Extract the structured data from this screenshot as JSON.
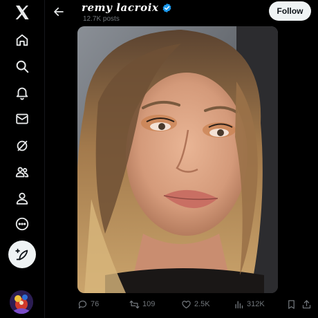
{
  "app": {
    "brand": "X"
  },
  "nav": {
    "items": [
      {
        "icon": "x-logo-icon"
      },
      {
        "icon": "home-icon"
      },
      {
        "icon": "search-icon"
      },
      {
        "icon": "bell-icon"
      },
      {
        "icon": "mail-icon"
      },
      {
        "icon": "grok-icon"
      },
      {
        "icon": "communities-icon"
      },
      {
        "icon": "profile-icon"
      },
      {
        "icon": "more-icon"
      }
    ],
    "compose_icon": "compose-post-icon"
  },
  "header": {
    "display_name": "remy lacroix",
    "post_count": "12.7K posts",
    "follow_label": "Follow",
    "verified_color": "#1d9bf0"
  },
  "actions": {
    "replies": "76",
    "reposts": "109",
    "likes": "2.5K",
    "views": "312K"
  },
  "colors": {
    "background": "#000000",
    "text": "#e7e9ea",
    "muted": "#71767b",
    "button": "#eff3f4"
  }
}
